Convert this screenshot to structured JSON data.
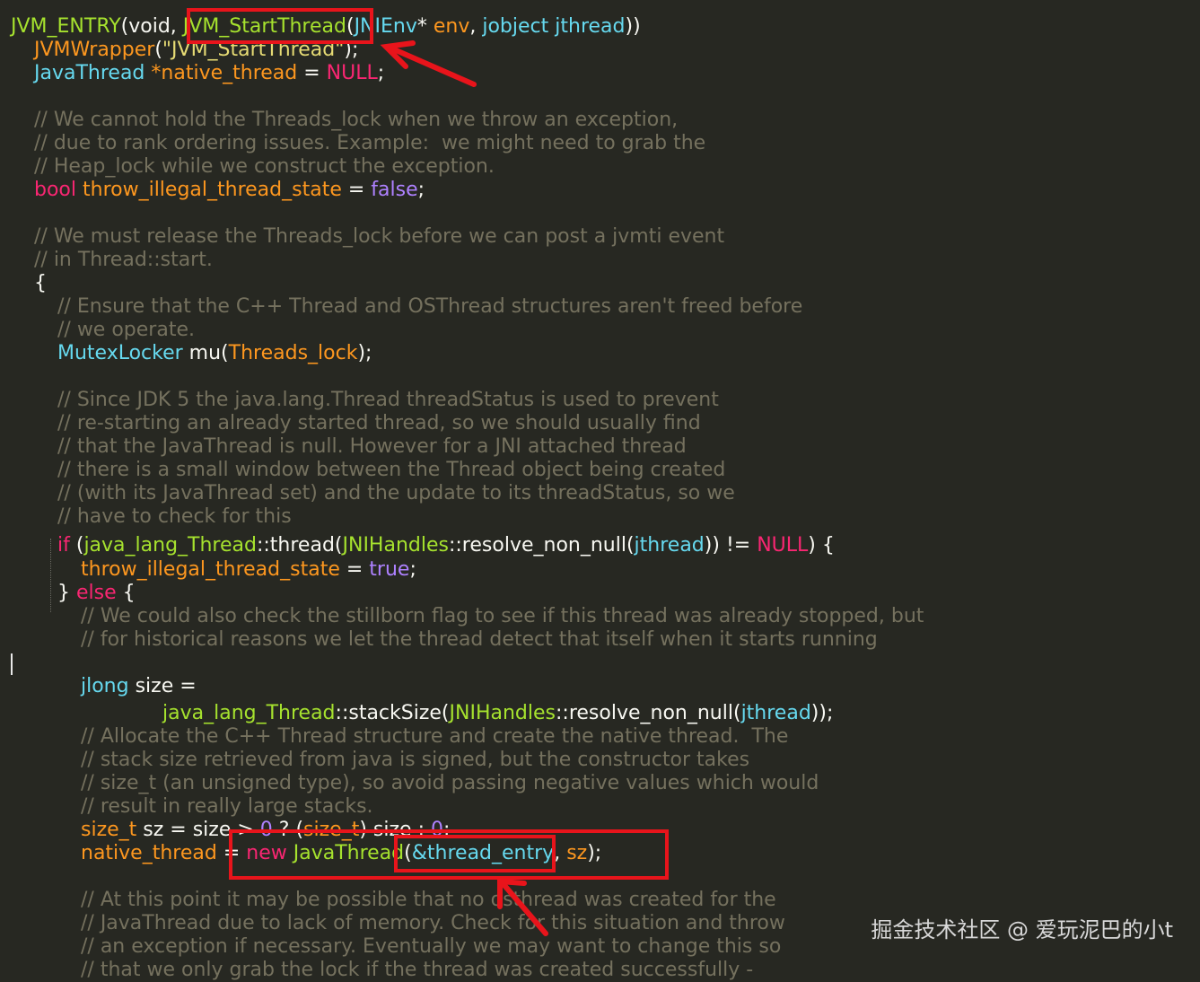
{
  "editor": {
    "lines": [
      {
        "indent": 0,
        "tokens": [
          [
            "fn",
            "JVM_ENTRY"
          ],
          [
            "pl",
            "(void, "
          ],
          [
            "fn",
            "JVM_StartThread"
          ],
          [
            "pl",
            "("
          ],
          [
            "ty",
            "JNIEnv"
          ],
          [
            "pl",
            "* "
          ],
          [
            "var",
            "env"
          ],
          [
            "pl",
            ", "
          ],
          [
            "ty",
            "jobject"
          ],
          [
            "pl",
            " "
          ],
          [
            "ty",
            "jthread"
          ],
          [
            "pl",
            "))"
          ]
        ]
      },
      {
        "indent": 1,
        "tokens": [
          [
            "var",
            "JVMWrapper"
          ],
          [
            "pl",
            "("
          ],
          [
            "str",
            "\"JVM_StartThread\""
          ],
          [
            "pl",
            ");"
          ]
        ]
      },
      {
        "indent": 1,
        "tokens": [
          [
            "ty",
            "JavaThread"
          ],
          [
            "pl",
            " "
          ],
          [
            "var",
            "*native_thread"
          ],
          [
            "pl",
            " = "
          ],
          [
            "nul",
            "NULL"
          ],
          [
            "pl",
            ";"
          ]
        ]
      },
      {
        "indent": 0,
        "tokens": []
      },
      {
        "indent": 1,
        "tokens": [
          [
            "cm",
            "// We cannot hold the Threads_lock when we throw an exception,"
          ]
        ]
      },
      {
        "indent": 1,
        "tokens": [
          [
            "cm",
            "// due to rank ordering issues. Example:  we might need to grab the"
          ]
        ]
      },
      {
        "indent": 1,
        "tokens": [
          [
            "cm",
            "// Heap_lock while we construct the exception."
          ]
        ]
      },
      {
        "indent": 1,
        "tokens": [
          [
            "kw",
            "bool"
          ],
          [
            "pl",
            " "
          ],
          [
            "var",
            "throw_illegal_thread_state"
          ],
          [
            "pl",
            " = "
          ],
          [
            "bl",
            "false"
          ],
          [
            "pl",
            ";"
          ]
        ]
      },
      {
        "indent": 0,
        "tokens": []
      },
      {
        "indent": 1,
        "tokens": [
          [
            "cm",
            "// We must release the Threads_lock before we can post a jvmti event"
          ]
        ]
      },
      {
        "indent": 1,
        "tokens": [
          [
            "cm",
            "// in Thread::start."
          ]
        ]
      },
      {
        "indent": 1,
        "tokens": [
          [
            "pl",
            "{"
          ]
        ]
      },
      {
        "indent": 2,
        "tokens": [
          [
            "cm",
            "// Ensure that the C++ Thread and OSThread structures aren't freed before"
          ]
        ]
      },
      {
        "indent": 2,
        "tokens": [
          [
            "cm",
            "// we operate."
          ]
        ]
      },
      {
        "indent": 2,
        "tokens": [
          [
            "ty",
            "MutexLocker"
          ],
          [
            "pl",
            " mu("
          ],
          [
            "var",
            "Threads_lock"
          ],
          [
            "pl",
            ");"
          ]
        ]
      },
      {
        "indent": 0,
        "tokens": []
      },
      {
        "indent": 2,
        "tokens": [
          [
            "cm",
            "// Since JDK 5 the java.lang.Thread threadStatus is used to prevent"
          ]
        ]
      },
      {
        "indent": 2,
        "tokens": [
          [
            "cm",
            "// re-starting an already started thread, so we should usually find"
          ]
        ]
      },
      {
        "indent": 2,
        "tokens": [
          [
            "cm",
            "// that the JavaThread is null. However for a JNI attached thread"
          ]
        ]
      },
      {
        "indent": 2,
        "tokens": [
          [
            "cm",
            "// there is a small window between the Thread object being created"
          ]
        ]
      },
      {
        "indent": 2,
        "tokens": [
          [
            "cm",
            "// (with its JavaThread set) and the update to its threadStatus, so we"
          ]
        ]
      },
      {
        "indent": 2,
        "tokens": [
          [
            "cm",
            "// have to check for this"
          ]
        ]
      },
      {
        "indent": 2,
        "tokens": [
          [
            "kw",
            "if"
          ],
          [
            "pl",
            " ("
          ],
          [
            "fn",
            "java_lang_Thread"
          ],
          [
            "pl",
            "::thread("
          ],
          [
            "fn",
            "JNIHandles"
          ],
          [
            "pl",
            "::resolve_non_null("
          ],
          [
            "ty",
            "jthread"
          ],
          [
            "pl",
            ")) != "
          ],
          [
            "nul",
            "NULL"
          ],
          [
            "pl",
            ") {"
          ]
        ]
      },
      {
        "indent": 3,
        "tokens": [
          [
            "var",
            "throw_illegal_thread_state"
          ],
          [
            "pl",
            " = "
          ],
          [
            "bl",
            "true"
          ],
          [
            "pl",
            ";"
          ]
        ]
      },
      {
        "indent": 2,
        "tokens": [
          [
            "pl",
            "} "
          ],
          [
            "kw",
            "else"
          ],
          [
            "pl",
            " {"
          ]
        ]
      },
      {
        "indent": 3,
        "tokens": [
          [
            "cm",
            "// We could also check the stillborn flag to see if this thread was already stopped, but"
          ]
        ]
      },
      {
        "indent": 3,
        "tokens": [
          [
            "cm",
            "// for historical reasons we let the thread detect that itself when it starts running"
          ]
        ]
      },
      {
        "indent": 0,
        "tokens": []
      },
      {
        "indent": 3,
        "tokens": [
          [
            "ty",
            "jlong"
          ],
          [
            "pl",
            " size ="
          ]
        ]
      },
      {
        "indent": 6.5,
        "tokens": [
          [
            "fn",
            "java_lang_Thread"
          ],
          [
            "pl",
            "::stackSize("
          ],
          [
            "fn",
            "JNIHandles"
          ],
          [
            "pl",
            "::resolve_non_null("
          ],
          [
            "ty",
            "jthread"
          ],
          [
            "pl",
            "));"
          ]
        ]
      },
      {
        "indent": 3,
        "tokens": [
          [
            "cm",
            "// Allocate the C++ Thread structure and create the native thread.  The"
          ]
        ]
      },
      {
        "indent": 3,
        "tokens": [
          [
            "cm",
            "// stack size retrieved from java is signed, but the constructor takes"
          ]
        ]
      },
      {
        "indent": 3,
        "tokens": [
          [
            "cm",
            "// size_t (an unsigned type), so avoid passing negative values which would"
          ]
        ]
      },
      {
        "indent": 3,
        "tokens": [
          [
            "cm",
            "// result in really large stacks."
          ]
        ]
      },
      {
        "indent": 3,
        "tokens": [
          [
            "var",
            "size_t"
          ],
          [
            "pl",
            " sz = size > "
          ],
          [
            "bl",
            "0"
          ],
          [
            "pl",
            " ? ("
          ],
          [
            "var",
            "size_t"
          ],
          [
            "pl",
            ") size : "
          ],
          [
            "bl",
            "0"
          ],
          [
            "pl",
            ";"
          ]
        ]
      },
      {
        "indent": 3,
        "tokens": [
          [
            "var",
            "native_thread"
          ],
          [
            "pl",
            " = "
          ],
          [
            "kw",
            "new"
          ],
          [
            "pl",
            " "
          ],
          [
            "fn",
            "JavaThread"
          ],
          [
            "pl",
            "("
          ],
          [
            "ty",
            "&thread_entry"
          ],
          [
            "pl",
            ", "
          ],
          [
            "var",
            "sz"
          ],
          [
            "pl",
            ");"
          ]
        ]
      },
      {
        "indent": 0,
        "tokens": []
      },
      {
        "indent": 3,
        "tokens": [
          [
            "cm",
            "// At this point it may be possible that no osthread was created for the"
          ]
        ]
      },
      {
        "indent": 3,
        "tokens": [
          [
            "cm",
            "// JavaThread due to lack of memory. Check for this situation and throw"
          ]
        ]
      },
      {
        "indent": 3,
        "tokens": [
          [
            "cm",
            "// an exception if necessary. Eventually we may want to change this so"
          ]
        ]
      },
      {
        "indent": 3,
        "tokens": [
          [
            "cm",
            "// that we only grab the lock if the thread was created successfully -"
          ]
        ]
      }
    ]
  },
  "colors": {
    "background": "#272822",
    "highlight_box": "#e8141b",
    "arrow": "#e8141b"
  },
  "watermark": {
    "text": "掘金技术社区 @ 爱玩泥巴的小t"
  }
}
